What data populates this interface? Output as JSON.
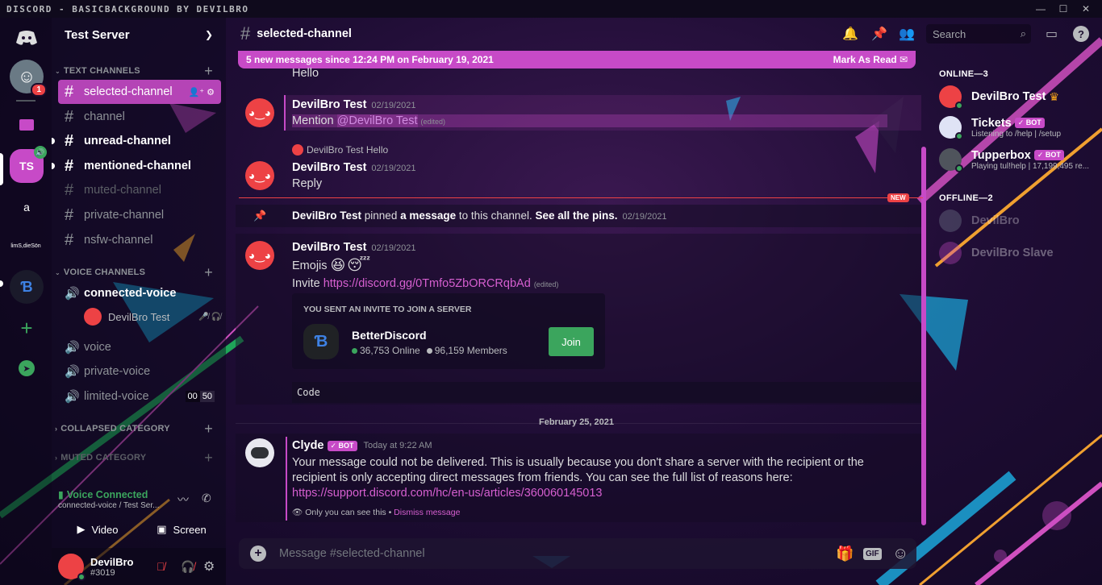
{
  "titlebar": {
    "title": "DISCORD - BASICBACKGROUND BY DEVILBRO"
  },
  "guilds": {
    "mention_count": "1",
    "ts_label": "TS",
    "a_label": "a",
    "lims_label": "limS,dieSön"
  },
  "server": {
    "name": "Test Server"
  },
  "categories": {
    "text": "TEXT CHANNELS",
    "voice": "VOICE CHANNELS",
    "collapsed": "COLLAPSED CATEGORY",
    "muted": "MUTED CATEGORY"
  },
  "channels": [
    {
      "name": "selected-channel"
    },
    {
      "name": "channel"
    },
    {
      "name": "unread-channel"
    },
    {
      "name": "mentioned-channel"
    },
    {
      "name": "muted-channel"
    },
    {
      "name": "private-channel"
    },
    {
      "name": "nsfw-channel"
    }
  ],
  "voice": {
    "connected": "connected-voice",
    "user": "DevilBro Test",
    "voice": "voice",
    "private": "private-voice",
    "limited": "limited-voice",
    "limit_count": "00",
    "limit_max": "50"
  },
  "voice_panel": {
    "status": "Voice Connected",
    "location": "connected-voice / Test Ser...",
    "video": "Video",
    "screen": "Screen"
  },
  "user": {
    "name": "DevilBro",
    "tag": "#3019"
  },
  "header": {
    "channel": "selected-channel",
    "search_placeholder": "Search"
  },
  "banner": {
    "text": "5 new messages since 12:24 PM on February 19, 2021",
    "action": "Mark As Read"
  },
  "messages": {
    "hello": "Hello",
    "m1": {
      "author": "DevilBro Test",
      "time": "02/19/2021",
      "prefix": "Mention ",
      "mention": "@DevilBro Test",
      "edited": "(edited)"
    },
    "m2": {
      "reply_author": "DevilBro Test",
      "reply_text": "Hello",
      "author": "DevilBro Test",
      "time": "02/19/2021",
      "text": "Reply"
    },
    "new_label": "NEW",
    "pin": {
      "author": "DevilBro Test",
      "t1": " pinned ",
      "t2": "a message",
      "t3": " to this channel. ",
      "t4": "See all the pins.",
      "time": "02/19/2021"
    },
    "m3": {
      "author": "DevilBro Test",
      "time": "02/19/2021",
      "emojis": "Emojis",
      "invite_prefix": "Invite ",
      "invite_link": "https://discord.gg/0Tmfo5ZbORCRqbAd",
      "edited": "(edited)"
    },
    "invite": {
      "header": "YOU SENT AN INVITE TO JOIN A SERVER",
      "server": "BetterDiscord",
      "online": "36,753 Online",
      "members": "96,159 Members",
      "join": "Join"
    },
    "code": "Code",
    "date_divider": "February 25, 2021",
    "clyde": {
      "author": "Clyde",
      "bot": "BOT",
      "time": "Today at 9:22 AM",
      "text": "Your message could not be delivered. This is usually because you don't share a server with the recipient or the recipient is only accepting direct messages from friends. You can see the full list of reasons here: ",
      "link": "https://support.discord.com/hc/en-us/articles/360060145013",
      "note": "Only you can see this • ",
      "dismiss": "Dismiss message"
    }
  },
  "composer": {
    "placeholder": "Message #selected-channel",
    "gif": "GIF"
  },
  "members": {
    "online_header": "ONLINE—3",
    "offline_header": "OFFLINE—2",
    "online": [
      {
        "name": "DevilBro Test",
        "sub": ""
      },
      {
        "name": "Tickets",
        "bot": "BOT",
        "sub": "Listening to /help | /setup"
      },
      {
        "name": "Tupperbox",
        "bot": "BOT",
        "sub": "Playing tul!help | 17,199,495 re..."
      }
    ],
    "offline": [
      {
        "name": "DevilBro"
      },
      {
        "name": "DevilBro Slave"
      }
    ]
  },
  "colors": {
    "accent": "#c74ac7",
    "online": "#3ba55d",
    "discord_red": "#ed4245",
    "join_green": "#3ba55d"
  }
}
